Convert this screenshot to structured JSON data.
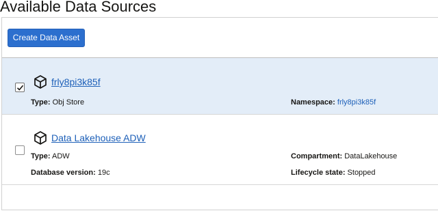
{
  "page": {
    "title": "Available Data Sources"
  },
  "toolbar": {
    "create_label": "Create Data Asset"
  },
  "sources": [
    {
      "name": "frly8pi3k85f",
      "selected": true,
      "icon": "cube-icon",
      "fields": {
        "type_label": "Type:",
        "type_value": "Obj Store",
        "namespace_label": "Namespace:",
        "namespace_value": "frly8pi3k85f"
      }
    },
    {
      "name": "Data Lakehouse ADW",
      "selected": false,
      "icon": "cube-icon",
      "fields": {
        "type_label": "Type:",
        "type_value": "ADW",
        "compartment_label": "Compartment:",
        "compartment_value": "DataLakehouse",
        "dbversion_label": "Database version:",
        "dbversion_value": "19c",
        "lifecycle_label": "Lifecycle state:",
        "lifecycle_value": "Stopped"
      }
    }
  ],
  "colors": {
    "accent": "#2c6fce",
    "link": "#1c5fb8",
    "selected_row": "#e3edf8"
  }
}
